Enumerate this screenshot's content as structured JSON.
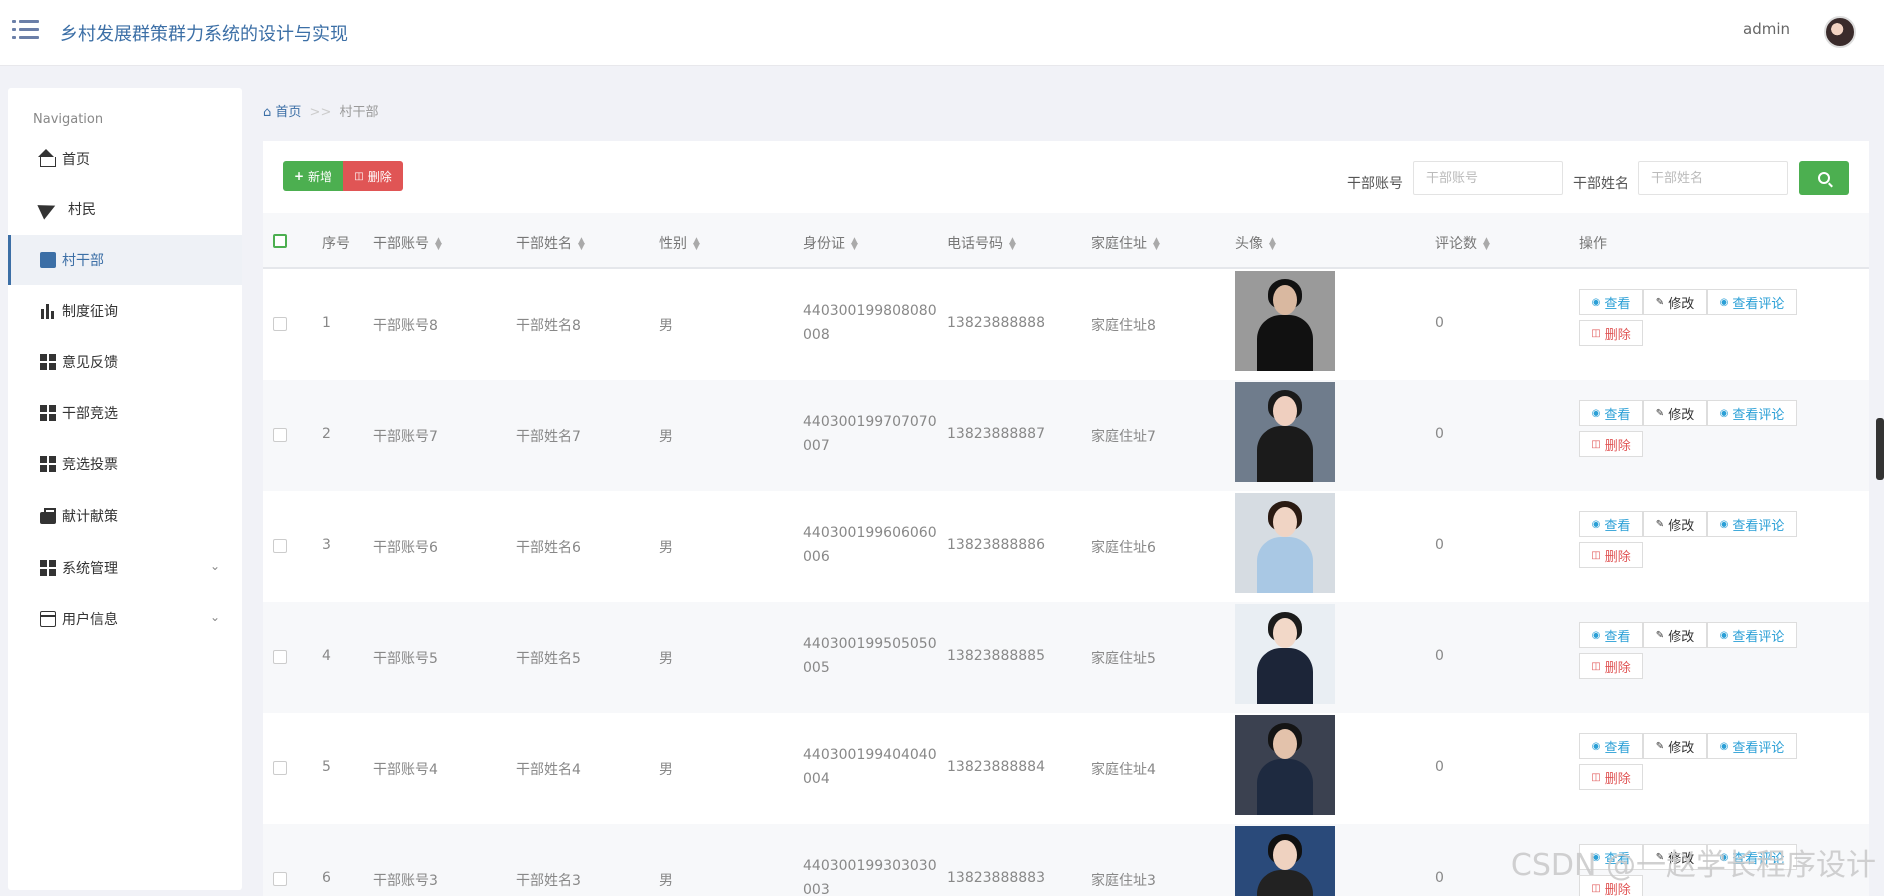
{
  "header": {
    "title": "乡村发展群策群力系统的设计与实现",
    "user": "admin"
  },
  "sidebar": {
    "heading": "Navigation",
    "items": [
      {
        "label": "首页",
        "icon": "home-icon"
      },
      {
        "label": "村民",
        "icon": "paper-plane-icon"
      },
      {
        "label": "村干部",
        "icon": "chart-icon",
        "active": true
      },
      {
        "label": "制度征询",
        "icon": "bar-chart-icon"
      },
      {
        "label": "意见反馈",
        "icon": "grid-icon"
      },
      {
        "label": "干部竞选",
        "icon": "grid-icon"
      },
      {
        "label": "竞选投票",
        "icon": "grid-icon"
      },
      {
        "label": "献计献策",
        "icon": "briefcase-icon"
      },
      {
        "label": "系统管理",
        "icon": "grid-icon",
        "expandable": true
      },
      {
        "label": "用户信息",
        "icon": "window-icon",
        "expandable": true
      }
    ]
  },
  "breadcrumb": {
    "home": "首页",
    "separator": ">>",
    "current": "村干部"
  },
  "toolbar": {
    "add_label": "新增",
    "delete_label": "删除",
    "account_label": "干部账号",
    "account_placeholder": "干部账号",
    "name_label": "干部姓名",
    "name_placeholder": "干部姓名"
  },
  "table": {
    "columns": [
      "序号",
      "干部账号",
      "干部姓名",
      "性别",
      "身份证",
      "电话号码",
      "家庭住址",
      "头像",
      "评论数",
      "操作"
    ],
    "actions": {
      "view": "查看",
      "edit": "修改",
      "comments": "查看评论",
      "delete": "删除"
    },
    "rows": [
      {
        "no": "1",
        "account": "干部账号8",
        "name": "干部姓名8",
        "gender": "男",
        "id_line1": "440300199808080",
        "id_line2": "008",
        "phone": "13823888888",
        "address": "家庭住址8",
        "comments": "0"
      },
      {
        "no": "2",
        "account": "干部账号7",
        "name": "干部姓名7",
        "gender": "男",
        "id_line1": "440300199707070",
        "id_line2": "007",
        "phone": "13823888887",
        "address": "家庭住址7",
        "comments": "0"
      },
      {
        "no": "3",
        "account": "干部账号6",
        "name": "干部姓名6",
        "gender": "男",
        "id_line1": "440300199606060",
        "id_line2": "006",
        "phone": "13823888886",
        "address": "家庭住址6",
        "comments": "0"
      },
      {
        "no": "4",
        "account": "干部账号5",
        "name": "干部姓名5",
        "gender": "男",
        "id_line1": "440300199505050",
        "id_line2": "005",
        "phone": "13823888885",
        "address": "家庭住址5",
        "comments": "0"
      },
      {
        "no": "5",
        "account": "干部账号4",
        "name": "干部姓名4",
        "gender": "男",
        "id_line1": "440300199404040",
        "id_line2": "004",
        "phone": "13823888884",
        "address": "家庭住址4",
        "comments": "0"
      },
      {
        "no": "6",
        "account": "干部账号3",
        "name": "干部姓名3",
        "gender": "男",
        "id_line1": "440300199303030",
        "id_line2": "003",
        "phone": "13823888883",
        "address": "家庭住址3",
        "comments": "0"
      }
    ]
  },
  "watermark": "CSDN @一赵学长程序设计",
  "colors": {
    "brand": "#3c6fa6",
    "add": "#4caf50",
    "delete": "#e05555",
    "link": "#2a9fd6"
  }
}
